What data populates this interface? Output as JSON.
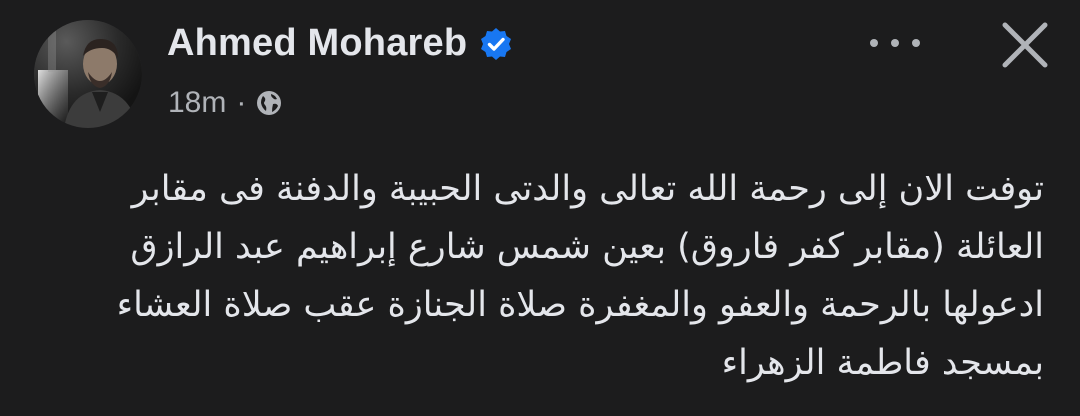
{
  "post": {
    "author_name": "Ahmed Mohareb",
    "verified_icon": "verified-badge-icon",
    "time_ago": "18m",
    "separator": "·",
    "audience_icon": "globe-icon",
    "more_icon": "more-options-icon",
    "close_icon": "close-icon",
    "text_lines": [
      "توفت الان إلى رحمة الله تعالى والدتى الحبيبة والدفنة فى مقابر",
      "العائلة (مقابر كفر فاروق) بعين شمس شارع إبراهيم عبد الرازق",
      "ادعولها بالرحمة والعفو والمغفرة صلاة الجنازة عقب صلاة العشاء",
      "بمسجد فاطمة الزهراء"
    ]
  },
  "colors": {
    "background": "#1c1c1d",
    "primary_text": "#e4e6eb",
    "secondary_text": "#b0b3b8",
    "verified_blue": "#1877f2"
  }
}
